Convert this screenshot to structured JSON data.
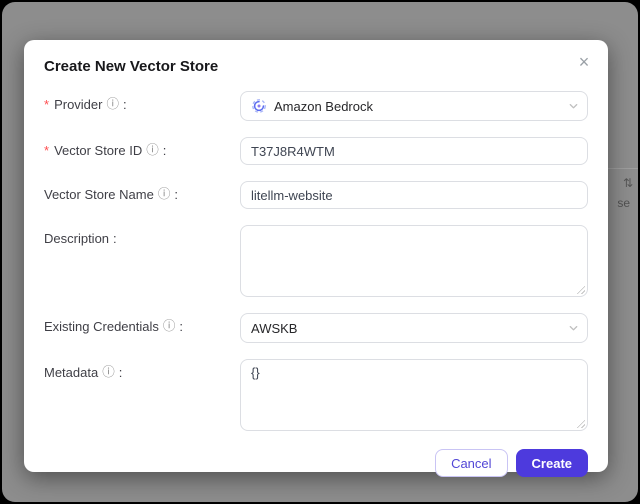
{
  "modal": {
    "title": "Create New Vector Store",
    "close_label": "×",
    "fields": [
      {
        "label": "Provider",
        "required": "*",
        "info": "ⓘ",
        "colon": ":",
        "value": "Amazon Bedrock",
        "icon": "bedrock-logo"
      },
      {
        "label": "Vector Store ID",
        "required": "*",
        "info": "ⓘ",
        "colon": ":",
        "value": "T37J8R4WTM"
      },
      {
        "label": "Vector Store Name",
        "info": "ⓘ",
        "colon": ":",
        "value": "litellm-website"
      },
      {
        "label": "Description",
        "colon": ":",
        "value": ""
      },
      {
        "label": "Existing Credentials",
        "info": "ⓘ",
        "colon": ":",
        "value": "AWSKB"
      },
      {
        "label": "Metadata",
        "info": "ⓘ",
        "colon": ":",
        "value": "{}"
      }
    ],
    "footer": {
      "cancel_label": "Cancel",
      "create_label": "Create"
    }
  },
  "background_page": {
    "sort_icon": "⇅",
    "partial_text": "se"
  },
  "colors": {
    "accent": "#4d3add",
    "cancel_border": "#c9c4f4",
    "required_mark": "#ff4d4f",
    "backdrop": "#8d8d8d",
    "input_border": "#dcdee3"
  }
}
